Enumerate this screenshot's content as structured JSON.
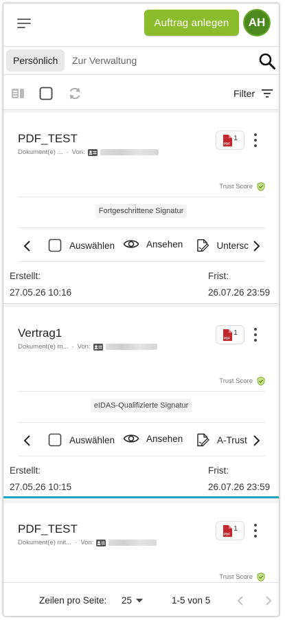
{
  "header": {
    "create_button_label": "Auftrag anlegen",
    "avatar_initials": "AH",
    "accent_color": "#8cbb2b"
  },
  "tabs": [
    {
      "label": "Persönlich",
      "active": true
    },
    {
      "label": "Zur Verwaltung",
      "active": false
    }
  ],
  "toolbar": {
    "filter_label": "Filter",
    "icons": [
      "split-view-icon",
      "select-all-checkbox",
      "refresh-icon",
      "filter-lines-icon"
    ]
  },
  "cards": [
    {
      "title": "PDF_TEST",
      "documents_label": "Dokument(e) ...",
      "from_label": "Von:",
      "pdf_count": "1",
      "trust_label": "Trust Score",
      "signature_type": "Fortgeschrittene Signatur",
      "actions": {
        "select": "Auswählen",
        "view": "Ansehen",
        "sign": "Untersc"
      },
      "created_label": "Erstellt:",
      "created_value": "27.05.26 10:16",
      "deadline_label": "Frist:",
      "deadline_value": "26.07.26 23:59"
    },
    {
      "title": "Vertrag1",
      "documents_label": "Dokument(e) m...",
      "from_label": "Von:",
      "pdf_count": "1",
      "trust_label": "Trust Score",
      "signature_type": "eIDAS-Qualifizierte Signatur",
      "actions": {
        "select": "Auswählen",
        "view": "Ansehen",
        "sign": "A-Trust"
      },
      "created_label": "Erstellt:",
      "created_value": "27.05.26 10:15",
      "deadline_label": "Frist:",
      "deadline_value": "26.07.26 23:59"
    },
    {
      "title": "PDF_TEST",
      "documents_label": "Dokument(e) mit...",
      "from_label": "Von:",
      "pdf_count": "1",
      "trust_label": "Trust Score"
    }
  ],
  "pagination": {
    "rows_per_page_label": "Zeilen pro Seite:",
    "rows_per_page_value": "25",
    "range_label": "1-5 von 5"
  }
}
